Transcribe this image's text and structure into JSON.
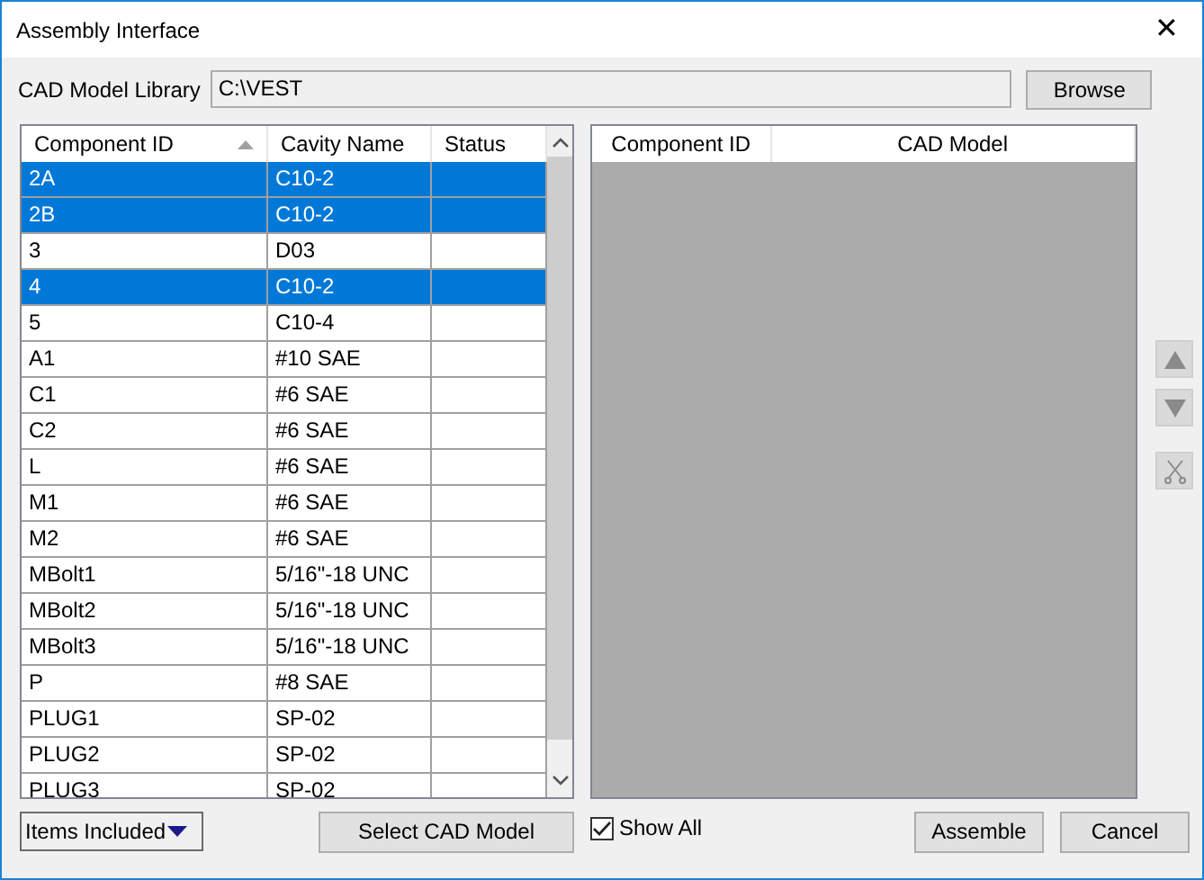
{
  "window": {
    "title": "Assembly Interface",
    "close": "✕"
  },
  "library": {
    "label": "CAD Model Library",
    "value": "C:\\VEST",
    "browse": "Browse"
  },
  "components_table": {
    "columns": [
      {
        "label": "Component ID",
        "sorted": true
      },
      {
        "label": "Cavity Name",
        "sorted": false
      },
      {
        "label": "Status",
        "sorted": false
      }
    ],
    "rows": [
      {
        "cells": [
          "2A",
          "C10-2",
          ""
        ],
        "selected": true
      },
      {
        "cells": [
          "2B",
          "C10-2",
          ""
        ],
        "selected": true
      },
      {
        "cells": [
          "3",
          "D03",
          ""
        ],
        "selected": false
      },
      {
        "cells": [
          "4",
          "C10-2",
          ""
        ],
        "selected": true
      },
      {
        "cells": [
          "5",
          "C10-4",
          ""
        ],
        "selected": false
      },
      {
        "cells": [
          "A1",
          "#10 SAE",
          ""
        ],
        "selected": false
      },
      {
        "cells": [
          "C1",
          "#6 SAE",
          ""
        ],
        "selected": false
      },
      {
        "cells": [
          "C2",
          "#6 SAE",
          ""
        ],
        "selected": false
      },
      {
        "cells": [
          "L",
          "#6 SAE",
          ""
        ],
        "selected": false
      },
      {
        "cells": [
          "M1",
          "#6 SAE",
          ""
        ],
        "selected": false
      },
      {
        "cells": [
          "M2",
          "#6 SAE",
          ""
        ],
        "selected": false
      },
      {
        "cells": [
          "MBolt1",
          "5/16\"-18 UNC",
          ""
        ],
        "selected": false
      },
      {
        "cells": [
          "MBolt2",
          "5/16\"-18 UNC",
          ""
        ],
        "selected": false
      },
      {
        "cells": [
          "MBolt3",
          "5/16\"-18 UNC",
          ""
        ],
        "selected": false
      },
      {
        "cells": [
          "P",
          "#8 SAE",
          ""
        ],
        "selected": false
      },
      {
        "cells": [
          "PLUG1",
          "SP-02",
          ""
        ],
        "selected": false
      },
      {
        "cells": [
          "PLUG2",
          "SP-02",
          ""
        ],
        "selected": false
      },
      {
        "cells": [
          "PLUG3",
          "SP-02",
          ""
        ],
        "selected": false
      }
    ]
  },
  "models_table": {
    "columns": [
      "Component ID",
      "CAD Model"
    ]
  },
  "side_buttons": [
    {
      "kind": "up",
      "disabled": true
    },
    {
      "kind": "down",
      "disabled": true
    },
    {
      "kind": "remove",
      "disabled": true
    }
  ],
  "bottom": {
    "filter": "Items Included",
    "select_button": "Select CAD Model",
    "show_all": {
      "label": "Show All",
      "checked": true
    },
    "buttons": [
      "Assemble",
      "Cancel"
    ]
  }
}
